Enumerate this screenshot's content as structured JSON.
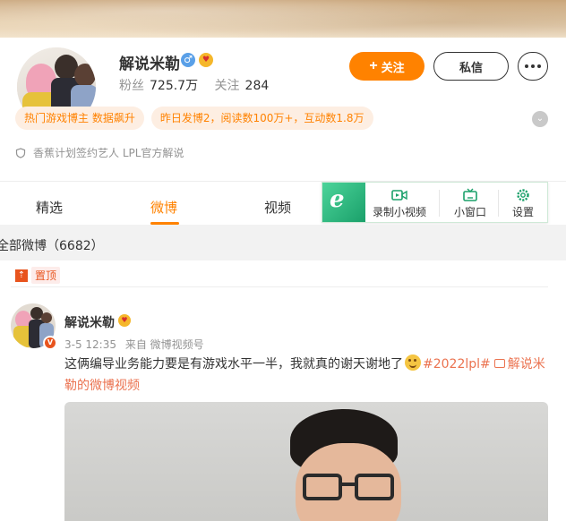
{
  "profile": {
    "name": "解说米勒",
    "gender_icon": "male-icon",
    "fans_label": "粉丝",
    "fans_value": "725.7万",
    "following_label": "关注",
    "following_value": "284",
    "follow_button": "关注",
    "message_button": "私信",
    "tags": [
      "热门游戏博主 数据飙升",
      "昨日发博2，阅读数100万+，互动数1.8万"
    ],
    "verification": "香蕉计划签约艺人 LPL官方解说",
    "verify_badge": "V"
  },
  "tabs": [
    {
      "label": "精选",
      "active": false
    },
    {
      "label": "微博",
      "active": true
    },
    {
      "label": "视频",
      "active": false
    }
  ],
  "ie_toolbar": {
    "logo": "e",
    "items": [
      {
        "label": "录制小视频",
        "icon": "record-video-icon"
      },
      {
        "label": "小窗口",
        "icon": "tv-icon"
      },
      {
        "label": "设置",
        "icon": "gear-icon"
      }
    ]
  },
  "feed": {
    "count_label": "全部微博（6682）",
    "pin_label": "置顶",
    "post": {
      "author": "解说米勒",
      "time": "3-5 12:35",
      "source": "来自 微博视频号",
      "text": "这俩编导业务能力要是有游戏水平一半，我就真的谢天谢地了",
      "hashtag": "#2022lpl#",
      "video_link": "解说米勒的微博视频"
    }
  },
  "colors": {
    "accent": "#ff8200",
    "tag_bg": "#fdeee2",
    "link": "#eb7350",
    "verify_badge": "#e8541e",
    "ie_green": "#1aa06a"
  }
}
